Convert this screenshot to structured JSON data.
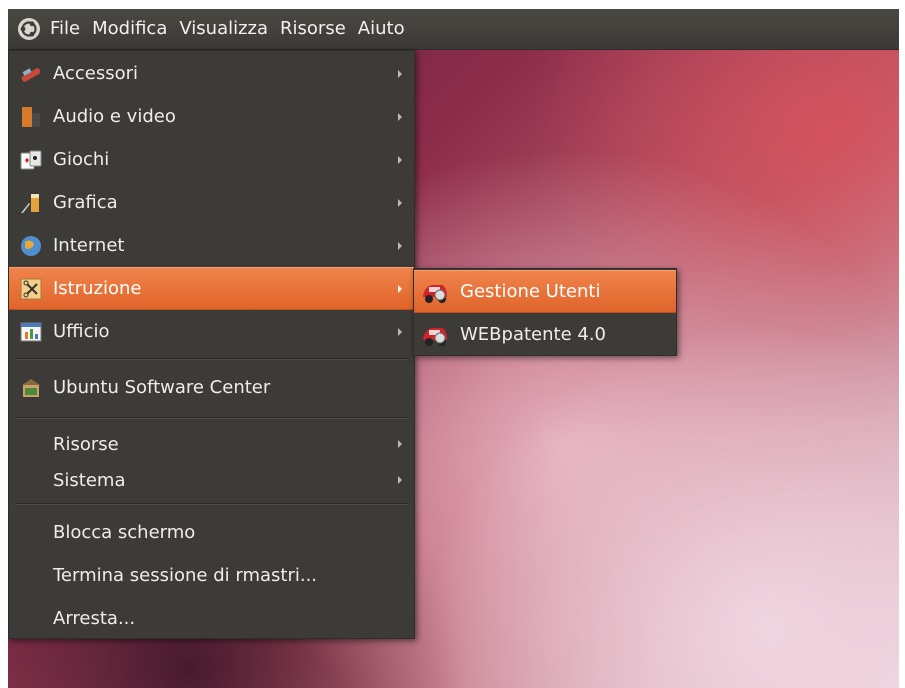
{
  "panel": {
    "menus": [
      "File",
      "Modifica",
      "Visualizza",
      "Risorse",
      "Aiuto"
    ]
  },
  "menu": {
    "items": [
      {
        "label": "Accessori",
        "icon": "accessories-icon"
      },
      {
        "label": "Audio e video",
        "icon": "multimedia-icon"
      },
      {
        "label": "Giochi",
        "icon": "games-icon"
      },
      {
        "label": "Grafica",
        "icon": "graphics-icon"
      },
      {
        "label": "Internet",
        "icon": "internet-globe-icon"
      },
      {
        "label": "Istruzione",
        "icon": "education-icon"
      },
      {
        "label": "Ufficio",
        "icon": "office-icon"
      },
      {
        "label": "Ubuntu Software Center",
        "icon": "software-center-icon"
      },
      {
        "label": "Risorse"
      },
      {
        "label": "Sistema"
      },
      {
        "label": "Blocca schermo"
      },
      {
        "label": "Termina sessione di rmastri..."
      },
      {
        "label": "Arresta..."
      }
    ]
  },
  "submenu": {
    "items": [
      {
        "label": "Gestione Utenti",
        "icon": "webpatente-car-icon"
      },
      {
        "label": "WEBpatente 4.0",
        "icon": "webpatente-car-icon"
      }
    ]
  },
  "colors": {
    "highlight": "#e5692f",
    "menu_bg": "#3c3b37",
    "panel_bg": "#3f3e3a"
  }
}
